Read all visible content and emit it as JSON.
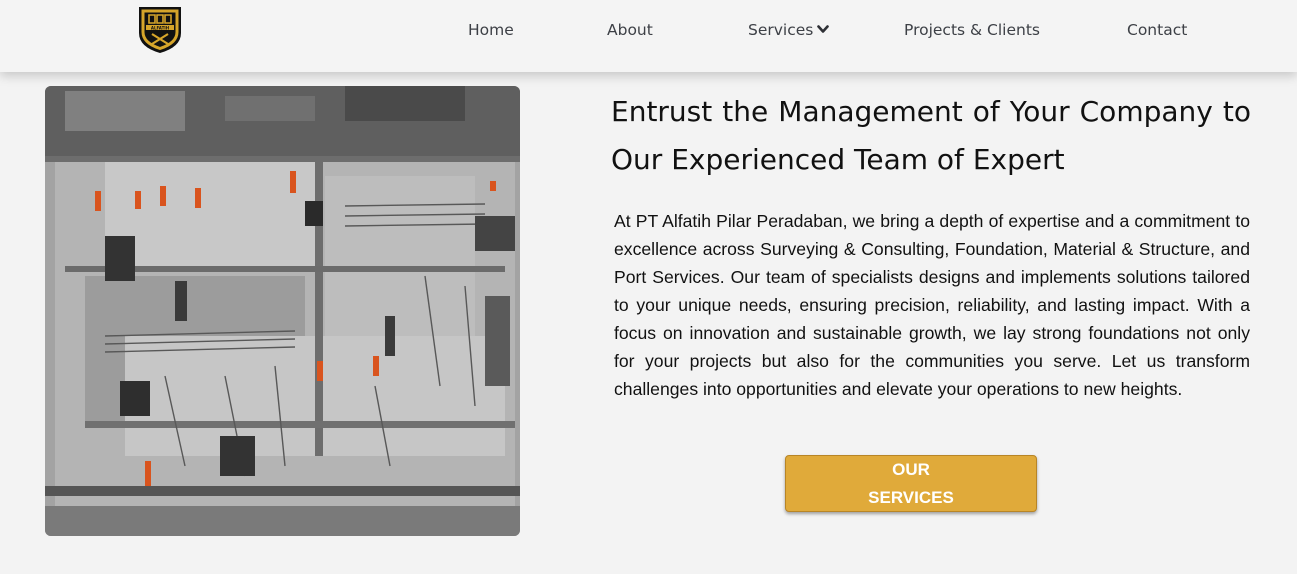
{
  "nav": {
    "logo_text": "ALFATIH",
    "items": [
      {
        "label": "Home"
      },
      {
        "label": "About"
      },
      {
        "label": "Services"
      },
      {
        "label": "Projects & Clients"
      },
      {
        "label": "Contact"
      }
    ]
  },
  "hero": {
    "headline": "Entrust the Management of Your Company to Our Experienced Team of Expert",
    "body": "At PT Alfatih Pilar Peradaban, we bring a depth of expertise and a commitment to excellence across Surveying & Consulting, Foundation, Material & Structure, and Port Services. Our team of specialists designs and implements solutions tailored to your unique needs, ensuring precision, reliability, and lasting impact. With a focus on innovation and sustainable growth, we lay strong foundations not only for your projects but also for the communities you serve. Let us transform challenges into opportunities and elevate your operations to new heights.",
    "cta_label": "OUR SERVICES",
    "image_icon": "construction-site-photo"
  },
  "colors": {
    "accent": "#e0aa3a",
    "logo_gold": "#d6a52a",
    "nav_text": "#3d4046",
    "background": "#f3f3f3"
  }
}
